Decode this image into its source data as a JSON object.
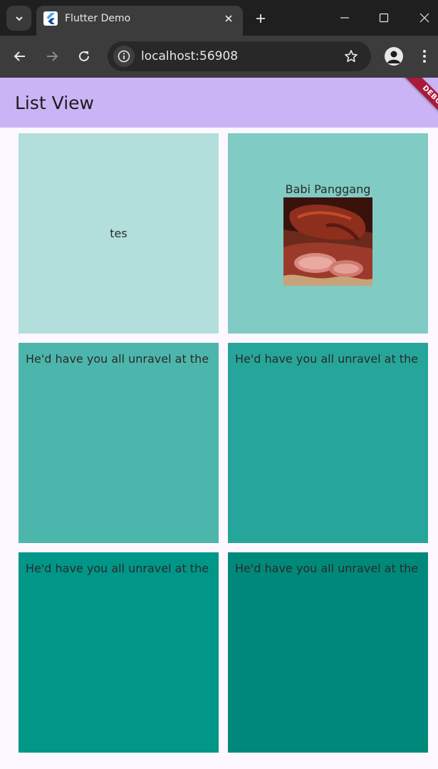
{
  "browser": {
    "tab_title": "Flutter Demo",
    "url": "localhost:56908"
  },
  "app": {
    "title": "List View",
    "debug_banner": "DEBUG"
  },
  "grid": {
    "tiles": [
      {
        "text": "tes",
        "color": "#b2dfdb"
      },
      {
        "label": "Babi Panggang",
        "image": "roast-pork-photo",
        "color": "#80cbc4"
      },
      {
        "text": "He'd have you all unravel at the",
        "color": "#4db6ac"
      },
      {
        "text": "He'd have you all unravel at the",
        "color": "#26a69a"
      },
      {
        "text": "He'd have you all unravel at the",
        "color": "#009688"
      },
      {
        "text": "He'd have you all unravel at the",
        "color": "#00897b"
      }
    ]
  },
  "colors": {
    "appbar": "#cbb4f5",
    "background": "#fdf7ff"
  }
}
